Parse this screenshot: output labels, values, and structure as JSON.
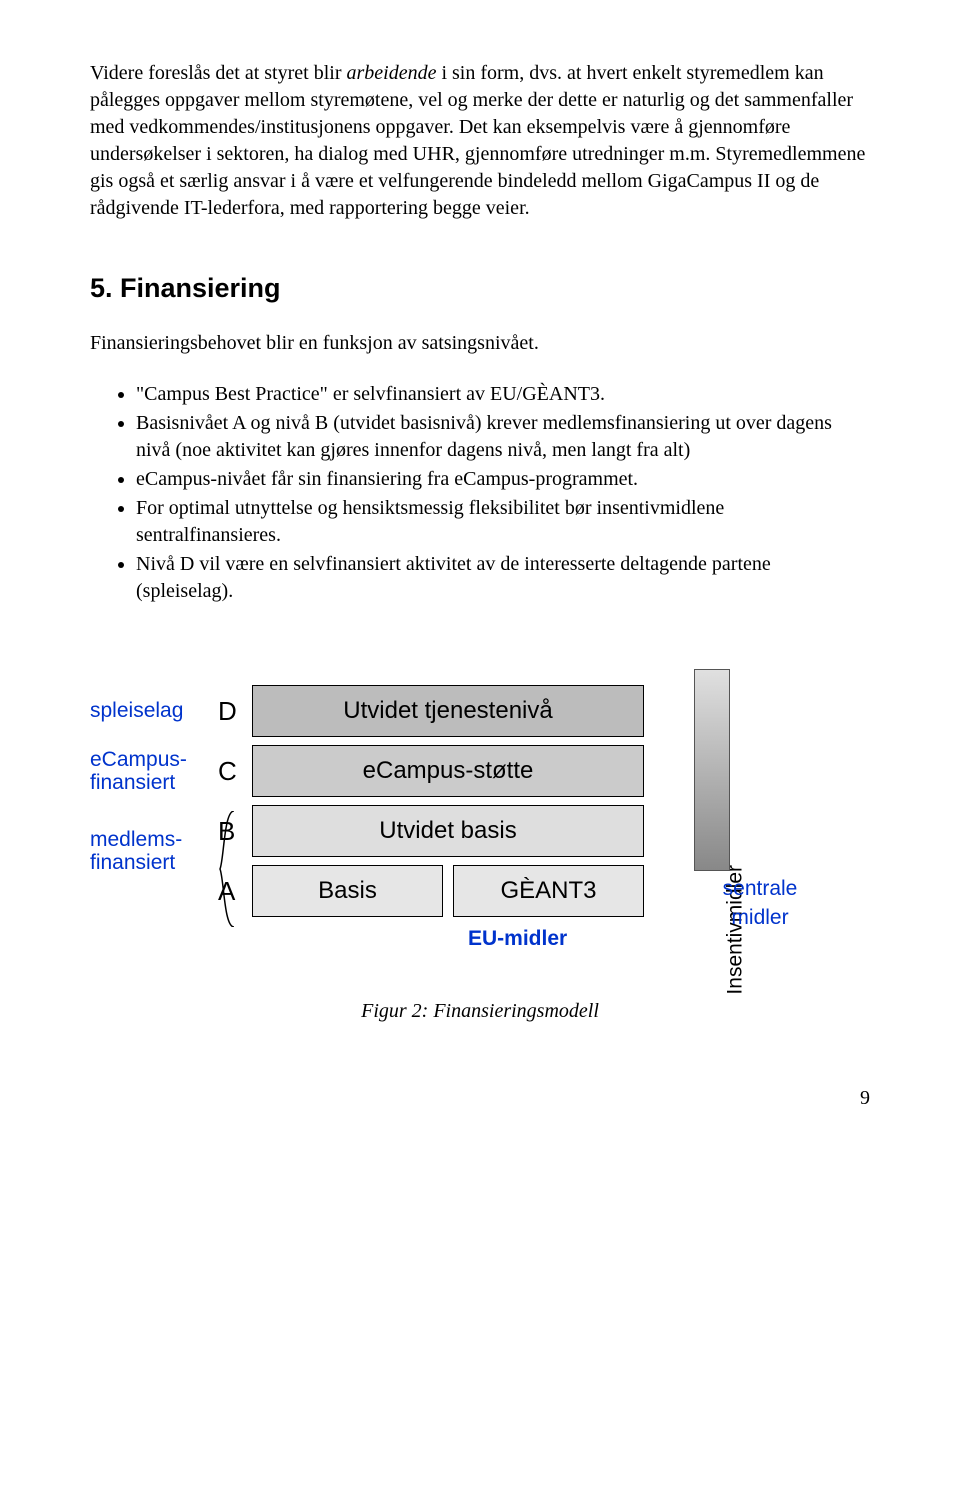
{
  "para1": {
    "t1": "Videre foreslås det at styret blir ",
    "italic": "arbeidende",
    "t2": " i sin form, dvs. at hvert enkelt styremedlem kan pålegges oppgaver mellom styremøtene, vel og merke der dette er naturlig og det sammenfaller med vedkommendes/institusjonens oppgaver. Det kan eksempelvis være å gjennomføre undersøkelser i sektoren, ha dialog med UHR, gjennomføre utredninger m.m. Styremedlemmene gis også et særlig ansvar i å være et velfungerende bindeledd mellom GigaCampus II og de rådgivende IT-lederfora, med rapportering begge veier."
  },
  "heading_5": "5. Finansiering",
  "para2": "Finansieringsbehovet blir en funksjon av satsingsnivået.",
  "bullets": [
    "\"Campus Best Practice\" er selvfinansiert av EU/GÈANT3.",
    "Basisnivået A og nivå B (utvidet basisnivå) krever medlemsfinansiering ut over dagens nivå (noe aktivitet kan gjøres innenfor dagens nivå, men langt fra alt)",
    "eCampus-nivået får sin finansiering fra eCampus-programmet.",
    "For optimal utnyttelse og hensiktsmessig fleksibilitet bør insentivmidlene sentralfinansieres.",
    "Nivå D vil være en selvfinansiert aktivitet av de interesserte deltagende partene (spleiselag)."
  ],
  "diagram": {
    "fin_labels": {
      "spleiselag": "spleiselag",
      "ecampus": "eCampus-finansiert",
      "medlems": "medlems-finansiert"
    },
    "levels": {
      "d": "D",
      "c": "C",
      "b": "B",
      "a": "A"
    },
    "bars": {
      "d": "Utvidet tjenestenivå",
      "c": "eCampus-støtte",
      "b": "Utvidet basis",
      "a1": "Basis",
      "a2": "GÈANT3"
    },
    "incentive": "Insentivmidler",
    "sentrale": "sentrale midler",
    "eu": "EU-midler",
    "caption": "Figur 2: Finansieringsmodell"
  },
  "pagenum": "9"
}
